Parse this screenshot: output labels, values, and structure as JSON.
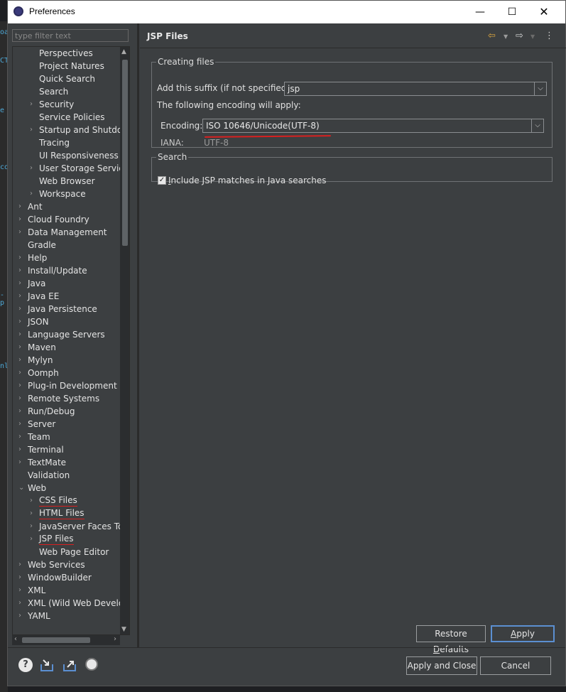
{
  "window": {
    "title": "Preferences",
    "min_glyph": "—",
    "max_glyph": "☐",
    "close_glyph": "✕"
  },
  "filter": {
    "placeholder": "type filter text"
  },
  "tree": [
    {
      "label": "Perspectives",
      "level": 2,
      "arrow": ""
    },
    {
      "label": "Project Natures",
      "level": 2,
      "arrow": ""
    },
    {
      "label": "Quick Search",
      "level": 2,
      "arrow": ""
    },
    {
      "label": "Search",
      "level": 2,
      "arrow": ""
    },
    {
      "label": "Security",
      "level": 2,
      "arrow": "›"
    },
    {
      "label": "Service Policies",
      "level": 2,
      "arrow": ""
    },
    {
      "label": "Startup and Shutdow",
      "level": 2,
      "arrow": "›"
    },
    {
      "label": "Tracing",
      "level": 2,
      "arrow": ""
    },
    {
      "label": "UI Responsiveness M",
      "level": 2,
      "arrow": ""
    },
    {
      "label": "User Storage Service",
      "level": 2,
      "arrow": "›"
    },
    {
      "label": "Web Browser",
      "level": 2,
      "arrow": ""
    },
    {
      "label": "Workspace",
      "level": 2,
      "arrow": "›"
    },
    {
      "label": "Ant",
      "level": 1,
      "arrow": "›"
    },
    {
      "label": "Cloud Foundry",
      "level": 1,
      "arrow": "›"
    },
    {
      "label": "Data Management",
      "level": 1,
      "arrow": "›"
    },
    {
      "label": "Gradle",
      "level": 1,
      "arrow": ""
    },
    {
      "label": "Help",
      "level": 1,
      "arrow": "›"
    },
    {
      "label": "Install/Update",
      "level": 1,
      "arrow": "›"
    },
    {
      "label": "Java",
      "level": 1,
      "arrow": "›"
    },
    {
      "label": "Java EE",
      "level": 1,
      "arrow": "›"
    },
    {
      "label": "Java Persistence",
      "level": 1,
      "arrow": "›"
    },
    {
      "label": "JSON",
      "level": 1,
      "arrow": "›"
    },
    {
      "label": "Language Servers",
      "level": 1,
      "arrow": "›"
    },
    {
      "label": "Maven",
      "level": 1,
      "arrow": "›"
    },
    {
      "label": "Mylyn",
      "level": 1,
      "arrow": "›"
    },
    {
      "label": "Oomph",
      "level": 1,
      "arrow": "›"
    },
    {
      "label": "Plug-in Development",
      "level": 1,
      "arrow": "›"
    },
    {
      "label": "Remote Systems",
      "level": 1,
      "arrow": "›"
    },
    {
      "label": "Run/Debug",
      "level": 1,
      "arrow": "›"
    },
    {
      "label": "Server",
      "level": 1,
      "arrow": "›"
    },
    {
      "label": "Team",
      "level": 1,
      "arrow": "›"
    },
    {
      "label": "Terminal",
      "level": 1,
      "arrow": "›"
    },
    {
      "label": "TextMate",
      "level": 1,
      "arrow": "›"
    },
    {
      "label": "Validation",
      "level": 1,
      "arrow": ""
    },
    {
      "label": "Web",
      "level": 1,
      "arrow": "⌄"
    },
    {
      "label": "CSS Files",
      "level": 2,
      "arrow": "›",
      "marked": true
    },
    {
      "label": "HTML Files",
      "level": 2,
      "arrow": "›",
      "marked": true
    },
    {
      "label": "JavaServer Faces Too",
      "level": 2,
      "arrow": "›"
    },
    {
      "label": "JSP Files",
      "level": 2,
      "arrow": "›",
      "marked": true
    },
    {
      "label": "Web Page Editor",
      "level": 2,
      "arrow": ""
    },
    {
      "label": "Web Services",
      "level": 1,
      "arrow": "›"
    },
    {
      "label": "WindowBuilder",
      "level": 1,
      "arrow": "›"
    },
    {
      "label": "XML",
      "level": 1,
      "arrow": "›"
    },
    {
      "label": "XML (Wild Web Develop",
      "level": 1,
      "arrow": "›"
    },
    {
      "label": "YAML",
      "level": 1,
      "arrow": "›"
    }
  ],
  "page": {
    "title": "JSP Files",
    "creating": {
      "legend": "Creating files",
      "suffix_label": "Add this suffix (if not specified):",
      "suffix_value": "jsp",
      "encoding_note": "The following encoding will apply:",
      "encoding_label": "Encoding:",
      "encoding_value": "ISO 10646/Unicode(UTF-8)",
      "iana_label": "IANA:",
      "iana_value": "UTF-8"
    },
    "search": {
      "legend": "Search",
      "include_label_first": "I",
      "include_label_rest": "nclude JSP matches in Java searches",
      "include_checked": true
    }
  },
  "buttons": {
    "restore_pre": "Restore ",
    "restore_u": "D",
    "restore_post": "efaults",
    "apply_u": "A",
    "apply_post": "pply",
    "apply_close": "Apply and Close",
    "cancel": "Cancel"
  },
  "footer": {
    "help_glyph": "?"
  },
  "colors": {
    "accent": "#5b8fd1",
    "annotation_red": "#d82020",
    "panel_bg": "#3c3f41"
  }
}
